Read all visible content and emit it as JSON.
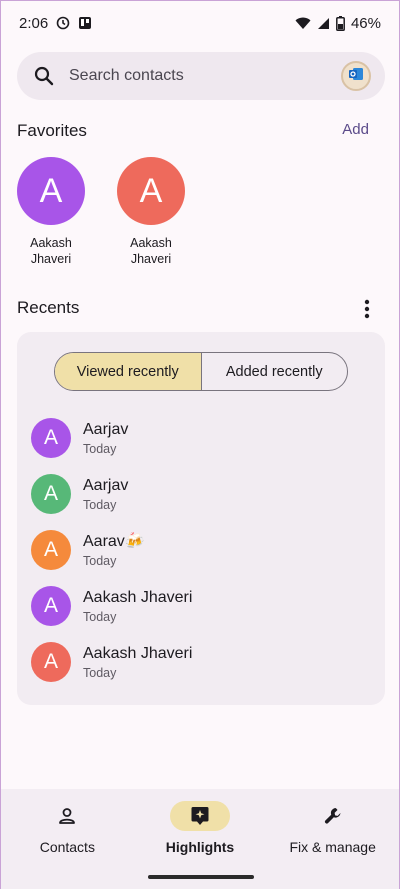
{
  "status_bar": {
    "time": "2:06",
    "battery": "46%",
    "icons": [
      "data-saver-icon",
      "trello-icon",
      "wifi-icon",
      "signal-icon",
      "battery-icon"
    ]
  },
  "search": {
    "placeholder": "Search contacts",
    "account_icon": "outlook-icon"
  },
  "favorites": {
    "title": "Favorites",
    "add_label": "Add",
    "items": [
      {
        "initial": "A",
        "name_line1": "Aakash",
        "name_line2": "Jhaveri",
        "color": "#a855e8"
      },
      {
        "initial": "A",
        "name_line1": "Aakash",
        "name_line2": "Jhaveri",
        "color": "#ee6a5c"
      }
    ]
  },
  "recents": {
    "title": "Recents",
    "tabs": [
      {
        "label": "Viewed recently",
        "selected": true
      },
      {
        "label": "Added recently",
        "selected": false
      }
    ],
    "items": [
      {
        "initial": "A",
        "name": "Aarjav",
        "time": "Today",
        "color": "#a855e8"
      },
      {
        "initial": "A",
        "name": "Aarjav",
        "time": "Today",
        "color": "#57b878"
      },
      {
        "initial": "A",
        "name": "Aarav🍻",
        "time": "Today",
        "color": "#f58a3c"
      },
      {
        "initial": "A",
        "name": "Aakash Jhaveri",
        "time": "Today",
        "color": "#a855e8"
      },
      {
        "initial": "A",
        "name": "Aakash Jhaveri",
        "time": "Today",
        "color": "#ee6a5c"
      }
    ]
  },
  "bottom_nav": {
    "items": [
      {
        "label": "Contacts",
        "icon": "person-icon",
        "active": false
      },
      {
        "label": "Highlights",
        "icon": "highlights-icon",
        "active": true
      },
      {
        "label": "Fix & manage",
        "icon": "wrench-icon",
        "active": false
      }
    ]
  }
}
